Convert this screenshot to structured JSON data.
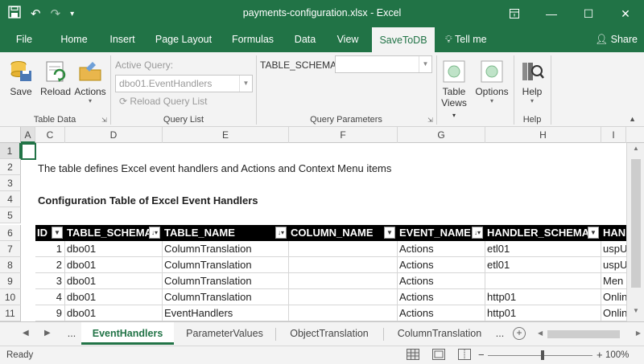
{
  "window": {
    "title": "payments-configuration.xlsx  -  Excel",
    "buttons": [
      "restore-icon",
      "minimize-icon",
      "maximize-icon",
      "close-icon"
    ]
  },
  "ribbon_tabs": [
    {
      "label": "File"
    },
    {
      "label": "Home"
    },
    {
      "label": "Insert"
    },
    {
      "label": "Page Layout"
    },
    {
      "label": "Formulas"
    },
    {
      "label": "Data"
    },
    {
      "label": "View"
    },
    {
      "label": "SaveToDB"
    }
  ],
  "tell_me": "Tell me",
  "share": "Share",
  "ribbon": {
    "save": "Save",
    "reload": "Reload",
    "actions": "Actions",
    "group_table_data": "Table Data",
    "active_query_label": "Active Query:",
    "active_query_value": "dbo01.EventHandlers",
    "reload_query_list": "Reload Query List",
    "group_query_list": "Query List",
    "param_label": "TABLE_SCHEMA:",
    "group_query_params": "Query Parameters",
    "table_views_1": "Table",
    "table_views_2": "Views",
    "options": "Options",
    "help": "Help",
    "group_help": "Help"
  },
  "columns": [
    "A",
    "C",
    "D",
    "E",
    "F",
    "G",
    "H",
    "I"
  ],
  "rows": [
    "1",
    "2",
    "3",
    "4",
    "5",
    "6",
    "7",
    "8",
    "9",
    "10",
    "11"
  ],
  "sheet": {
    "description": "The table defines Excel event handlers and Actions and Context Menu items",
    "heading": "Configuration Table of Excel Event Handlers",
    "headers": [
      "ID",
      "TABLE_SCHEMA",
      "TABLE_NAME",
      "COLUMN_NAME",
      "EVENT_NAME",
      "HANDLER_SCHEMA",
      "HAN"
    ],
    "data": [
      [
        "1",
        "dbo01",
        "ColumnTranslation",
        "",
        "Actions",
        "etl01",
        "uspU"
      ],
      [
        "2",
        "dbo01",
        "ColumnTranslation",
        "",
        "Actions",
        "etl01",
        "uspU"
      ],
      [
        "3",
        "dbo01",
        "ColumnTranslation",
        "",
        "Actions",
        "",
        "Men"
      ],
      [
        "4",
        "dbo01",
        "ColumnTranslation",
        "",
        "Actions",
        "http01",
        "Onlin"
      ],
      [
        "9",
        "dbo01",
        "EventHandlers",
        "",
        "Actions",
        "http01",
        "Onlin"
      ]
    ]
  },
  "sheet_tabs": {
    "ellipsis": "...",
    "tabs": [
      "EventHandlers",
      "ParameterValues",
      "ObjectTranslation",
      "ColumnTranslation"
    ],
    "more": "..."
  },
  "status": {
    "ready": "Ready",
    "zoom": "100%"
  },
  "colors": {
    "excel_green": "#217346",
    "table_header": "#000000"
  }
}
